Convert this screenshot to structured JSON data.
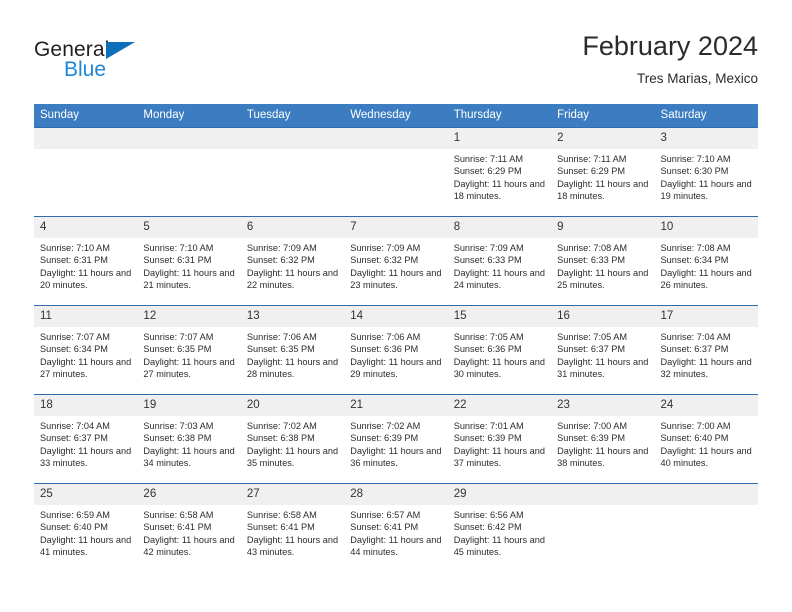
{
  "brand": {
    "name_part1": "General",
    "name_part2": "Blue",
    "triangle_icon": "blue-triangle-logo-mark",
    "colors": {
      "general_text": "#231f20",
      "blue_text": "#1f87d8",
      "triangle": "#0d6fb8"
    }
  },
  "header": {
    "title": "February 2024",
    "subtitle": "Tres Marias, Mexico"
  },
  "calendar": {
    "colors": {
      "header_background": "#3b7dc0",
      "header_text": "#ffffff",
      "daynum_background": "#f0f0f0",
      "row_border": "#2f6cad"
    },
    "weekday_headers": [
      "Sunday",
      "Monday",
      "Tuesday",
      "Wednesday",
      "Thursday",
      "Friday",
      "Saturday"
    ],
    "weeks": [
      [
        {
          "day": "",
          "details": ""
        },
        {
          "day": "",
          "details": ""
        },
        {
          "day": "",
          "details": ""
        },
        {
          "day": "",
          "details": ""
        },
        {
          "day": "1",
          "details": "Sunrise: 7:11 AM\nSunset: 6:29 PM\nDaylight: 11 hours and 18 minutes."
        },
        {
          "day": "2",
          "details": "Sunrise: 7:11 AM\nSunset: 6:29 PM\nDaylight: 11 hours and 18 minutes."
        },
        {
          "day": "3",
          "details": "Sunrise: 7:10 AM\nSunset: 6:30 PM\nDaylight: 11 hours and 19 minutes."
        }
      ],
      [
        {
          "day": "4",
          "details": "Sunrise: 7:10 AM\nSunset: 6:31 PM\nDaylight: 11 hours and 20 minutes."
        },
        {
          "day": "5",
          "details": "Sunrise: 7:10 AM\nSunset: 6:31 PM\nDaylight: 11 hours and 21 minutes."
        },
        {
          "day": "6",
          "details": "Sunrise: 7:09 AM\nSunset: 6:32 PM\nDaylight: 11 hours and 22 minutes."
        },
        {
          "day": "7",
          "details": "Sunrise: 7:09 AM\nSunset: 6:32 PM\nDaylight: 11 hours and 23 minutes."
        },
        {
          "day": "8",
          "details": "Sunrise: 7:09 AM\nSunset: 6:33 PM\nDaylight: 11 hours and 24 minutes."
        },
        {
          "day": "9",
          "details": "Sunrise: 7:08 AM\nSunset: 6:33 PM\nDaylight: 11 hours and 25 minutes."
        },
        {
          "day": "10",
          "details": "Sunrise: 7:08 AM\nSunset: 6:34 PM\nDaylight: 11 hours and 26 minutes."
        }
      ],
      [
        {
          "day": "11",
          "details": "Sunrise: 7:07 AM\nSunset: 6:34 PM\nDaylight: 11 hours and 27 minutes."
        },
        {
          "day": "12",
          "details": "Sunrise: 7:07 AM\nSunset: 6:35 PM\nDaylight: 11 hours and 27 minutes."
        },
        {
          "day": "13",
          "details": "Sunrise: 7:06 AM\nSunset: 6:35 PM\nDaylight: 11 hours and 28 minutes."
        },
        {
          "day": "14",
          "details": "Sunrise: 7:06 AM\nSunset: 6:36 PM\nDaylight: 11 hours and 29 minutes."
        },
        {
          "day": "15",
          "details": "Sunrise: 7:05 AM\nSunset: 6:36 PM\nDaylight: 11 hours and 30 minutes."
        },
        {
          "day": "16",
          "details": "Sunrise: 7:05 AM\nSunset: 6:37 PM\nDaylight: 11 hours and 31 minutes."
        },
        {
          "day": "17",
          "details": "Sunrise: 7:04 AM\nSunset: 6:37 PM\nDaylight: 11 hours and 32 minutes."
        }
      ],
      [
        {
          "day": "18",
          "details": "Sunrise: 7:04 AM\nSunset: 6:37 PM\nDaylight: 11 hours and 33 minutes."
        },
        {
          "day": "19",
          "details": "Sunrise: 7:03 AM\nSunset: 6:38 PM\nDaylight: 11 hours and 34 minutes."
        },
        {
          "day": "20",
          "details": "Sunrise: 7:02 AM\nSunset: 6:38 PM\nDaylight: 11 hours and 35 minutes."
        },
        {
          "day": "21",
          "details": "Sunrise: 7:02 AM\nSunset: 6:39 PM\nDaylight: 11 hours and 36 minutes."
        },
        {
          "day": "22",
          "details": "Sunrise: 7:01 AM\nSunset: 6:39 PM\nDaylight: 11 hours and 37 minutes."
        },
        {
          "day": "23",
          "details": "Sunrise: 7:00 AM\nSunset: 6:39 PM\nDaylight: 11 hours and 38 minutes."
        },
        {
          "day": "24",
          "details": "Sunrise: 7:00 AM\nSunset: 6:40 PM\nDaylight: 11 hours and 40 minutes."
        }
      ],
      [
        {
          "day": "25",
          "details": "Sunrise: 6:59 AM\nSunset: 6:40 PM\nDaylight: 11 hours and 41 minutes."
        },
        {
          "day": "26",
          "details": "Sunrise: 6:58 AM\nSunset: 6:41 PM\nDaylight: 11 hours and 42 minutes."
        },
        {
          "day": "27",
          "details": "Sunrise: 6:58 AM\nSunset: 6:41 PM\nDaylight: 11 hours and 43 minutes."
        },
        {
          "day": "28",
          "details": "Sunrise: 6:57 AM\nSunset: 6:41 PM\nDaylight: 11 hours and 44 minutes."
        },
        {
          "day": "29",
          "details": "Sunrise: 6:56 AM\nSunset: 6:42 PM\nDaylight: 11 hours and 45 minutes."
        },
        {
          "day": "",
          "details": ""
        },
        {
          "day": "",
          "details": ""
        }
      ]
    ]
  }
}
